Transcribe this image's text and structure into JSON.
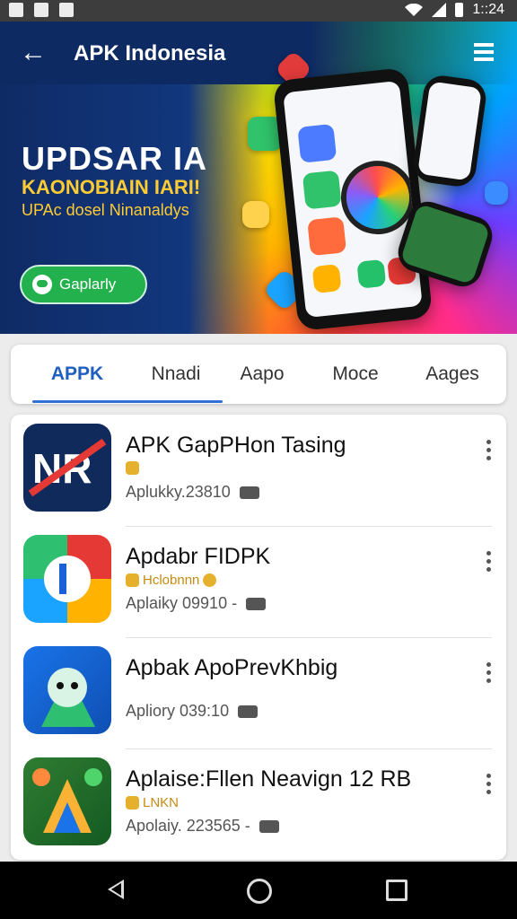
{
  "status_bar": {
    "time": "1::24"
  },
  "header": {
    "title": "APK Indonesia"
  },
  "banner": {
    "headline": "UPDSAR IA",
    "subheadline": "KAONOBIAIN IARI!",
    "tagline": "UPAc dosel Ninanaldys",
    "button_label": "Gaplarly"
  },
  "tabs": [
    {
      "label": "APPK"
    },
    {
      "label": "Nnadi"
    },
    {
      "label": "Aapo"
    },
    {
      "label": "Moce"
    },
    {
      "label": "Aages"
    }
  ],
  "apps": [
    {
      "name": "APK GapPHon Tasing",
      "tag": "",
      "subtitle": "Aplukky.23810"
    },
    {
      "name": "Apdabr FIDPK",
      "tag": "Hclobnnn",
      "subtitle": "Aplaiky 09910 -"
    },
    {
      "name": "Apbak ApoPrevKhbig",
      "tag": "",
      "subtitle": "Apliory 039:10"
    },
    {
      "name": "Aplaise:Fllen Neavign 12 RB",
      "tag": "LNKN",
      "subtitle": "Apolaiy. 223565 -"
    }
  ],
  "icons": {
    "back": "arrow-left-icon",
    "menu": "menu-list-icon",
    "more": "more-vert-icon"
  },
  "colors": {
    "primary": "#1f5fbf",
    "header_bg": "#0e2a63",
    "cta": "#23b14d"
  }
}
